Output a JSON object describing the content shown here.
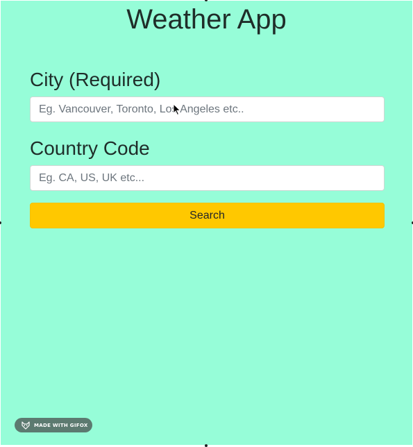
{
  "app": {
    "title": "Weather App",
    "background_color": "#96fdd8"
  },
  "form": {
    "city_label": "City (Required)",
    "city_placeholder": "Eg. Vancouver, Toronto, Los Angeles etc..",
    "city_value": "",
    "country_label": "Country Code",
    "country_placeholder": "Eg. CA, US, UK etc...",
    "country_value": "",
    "search_label": "Search",
    "search_button_color": "#ffc800"
  },
  "badge": {
    "text": "MADE WITH GIFOX",
    "icon": "fox-icon"
  }
}
